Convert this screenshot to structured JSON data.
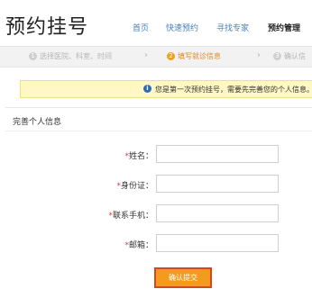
{
  "page": {
    "title": "预约挂号"
  },
  "nav": {
    "items": [
      {
        "label": "首页"
      },
      {
        "label": "快速预约"
      },
      {
        "label": "寻找专家"
      },
      {
        "label": "预约管理"
      }
    ]
  },
  "steps": {
    "items": [
      {
        "num": "1",
        "label": "选择医院、科室、时间"
      },
      {
        "num": "2",
        "label": "填写就诊信息"
      },
      {
        "num": "3",
        "label": "确认信"
      }
    ],
    "current_index": 1,
    "separator": "›"
  },
  "notice": {
    "icon": "info-icon",
    "icon_glyph": "i",
    "text": "您是第一次预约挂号，需要先完善您的个人信息。"
  },
  "form": {
    "section_title": "完善个人信息",
    "required_mark": "*",
    "fields": [
      {
        "label": "姓名：",
        "value": ""
      },
      {
        "label": "身份证：",
        "value": ""
      },
      {
        "label": "联系手机：",
        "value": ""
      },
      {
        "label": "邮箱：",
        "value": ""
      }
    ],
    "submit_label": "确认提交"
  },
  "colors": {
    "accent": "#f39a1f",
    "link": "#4a7fb5",
    "required": "#e53b3b",
    "notice_bg": "#fff8c4"
  }
}
